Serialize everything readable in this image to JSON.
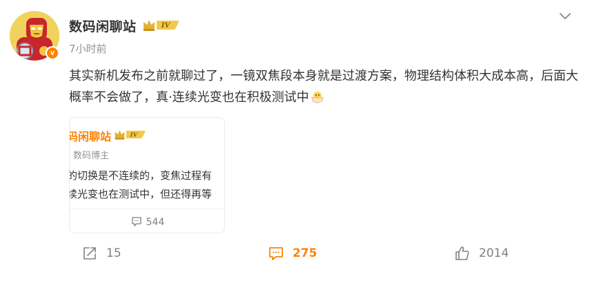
{
  "post": {
    "author_name": "数码闲聊站",
    "author_level": "IV",
    "verified_badge": "v",
    "time": "7小时前",
    "text": "其实新机发布之前就聊过了，一镜双焦段本身就是过渡方案，物理结构体积大成本高，后面大概率不会做了，真·连续光变也在积极测试中",
    "text_emoji": "bird-hatching-emoji"
  },
  "quoted": {
    "author_name": "码闲聊站",
    "author_level": "IV",
    "subtitle": "数码博主",
    "line1": "的切换是不连续的，变焦过程有",
    "line2": "续光变也在测试中，但还得再等",
    "comments_count": "544"
  },
  "actions": {
    "forward_count": "15",
    "comment_count": "275",
    "like_count": "2014"
  },
  "colors": {
    "accent": "#ff8200",
    "text": "#333333",
    "muted": "#939393",
    "level_gold": "#e5b033"
  }
}
